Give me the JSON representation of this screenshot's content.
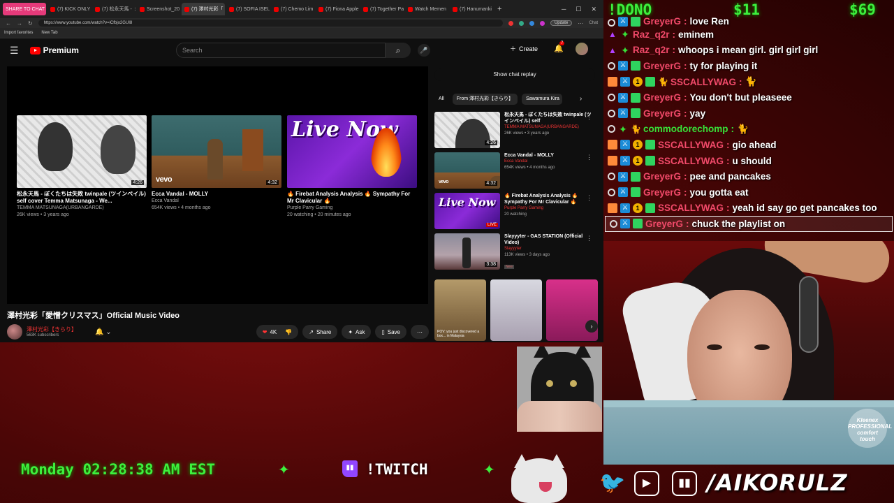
{
  "browser": {
    "tabs": [
      {
        "label": "SHARE TO CHAT",
        "active": false,
        "style": "pink"
      },
      {
        "label": "(7) KICK ONLY",
        "active": false
      },
      {
        "label": "(7) 松永天馬 -",
        "active": false
      },
      {
        "label": "Screenshot_20",
        "active": false
      },
      {
        "label": "(7) 澤村光彩「",
        "active": true
      },
      {
        "label": "(7) SOFIA ISELL",
        "active": false
      },
      {
        "label": "(7) Chemo Lim",
        "active": false
      },
      {
        "label": "(7) Fiona Apple",
        "active": false
      },
      {
        "label": "(7) Together Pa",
        "active": false
      },
      {
        "label": "Watch Memen",
        "active": false
      },
      {
        "label": "(7) Hanumanki",
        "active": false
      }
    ],
    "url": "https://www.youtube.com/watch?v=iCfbjo2GUI8",
    "update_label": "Update",
    "chat_label": "Chat",
    "bookmarks": [
      "Import favorites",
      "New Tab"
    ]
  },
  "youtube": {
    "logo": "Premium",
    "search_placeholder": "Search",
    "create_label": "Create",
    "notif_count": "7",
    "endcards": [
      {
        "title": "松永天馬 - ぼくたちは失敗 twinpale (ツインペイル) self cover Temma Matsunaga - We...",
        "channel": "TEMMA MATSUNAGA(URBANGARDE)",
        "meta": "26K views • 3 years ago",
        "duration": "4:26",
        "kind": "manga"
      },
      {
        "title": "Ecca Vandal - MOLLY",
        "channel": "Ecca Vandal",
        "meta": "654K views • 4 months ago",
        "duration": "4:32",
        "kind": "room",
        "overlay": "vevo"
      },
      {
        "title": "🔥 Firebat Analysis Analysis 🔥 Sympathy For Mr Clavicular 🔥",
        "channel": "Purple Parry Gaming",
        "meta": "20 watching • 20 minutes ago",
        "kind": "live",
        "overlay": "Live Now"
      }
    ],
    "video_title": "澤村光彩「愛憎クリスマス」Official Music Video",
    "channel_name": "澤村光彩【きらり】",
    "subscribers": "563K subscribers",
    "likes": "4K",
    "share_label": "Share",
    "ask_label": "Ask",
    "save_label": "Save",
    "show_chat_replay": "Show chat replay",
    "chips": [
      {
        "label": "All",
        "selected": false
      },
      {
        "label": "From 澤村光彩【きらり】",
        "selected": true
      },
      {
        "label": "Sawamura Kira",
        "selected": false
      }
    ],
    "recommendations": [
      {
        "title": "松永天馬 - ぼくたちは失敗 twinpale (ツインペイル) self",
        "channel": "TEMMA MATSUNAGA(URBANGARDE)",
        "meta": "26K views • 3 years ago",
        "duration": "4:26",
        "kind": "manga"
      },
      {
        "title": "Ecca Vandal - MOLLY",
        "channel": "Ecca Vandal",
        "meta": "654K views • 4 months ago",
        "duration": "4:32",
        "kind": "room",
        "overlay": "vevo"
      },
      {
        "title": "🔥 Firebat Analysis Analysis 🔥 Sympathy For Mr Clavicular 🔥",
        "channel": "Purple Parry Gaming",
        "meta": "20 watching",
        "badge": "LIVE",
        "kind": "live",
        "overlay": "Live Now"
      },
      {
        "title": "Slayyyter - GAS STATION (Official Video)",
        "channel": "Slayyyter",
        "meta": "113K views • 3 days ago",
        "duration": "3:38",
        "badge": "New",
        "kind": "stage"
      }
    ],
    "shorts": [
      {
        "caption": "POV: you just discovered a box... in Malaysia"
      },
      {
        "caption": ""
      },
      {
        "caption": ""
      }
    ]
  },
  "overlay": {
    "dono_cmd": "!DONO",
    "dono_amount_1": "$11",
    "dono_amount_2": "$69",
    "chat": [
      {
        "user": "GreyerG",
        "text": "love Ren",
        "color": "red",
        "badges": [
          "user",
          "sword",
          "gift"
        ],
        "partial": true
      },
      {
        "user": "Raz_q2r",
        "text": "eminem",
        "color": "red",
        "badges": [
          "crown",
          "star"
        ]
      },
      {
        "user": "Raz_q2r",
        "text": "whoops i mean girl. girl girl girl",
        "color": "red",
        "badges": [
          "crown",
          "star"
        ]
      },
      {
        "user": "GreyerG",
        "text": "ty for playing it",
        "color": "red",
        "badges": [
          "user",
          "sword",
          "gift"
        ]
      },
      {
        "user": "SSCALLYWAG",
        "text": "🐈",
        "color": "red",
        "badges": [
          "mod",
          "sword",
          "one",
          "gift",
          "cat"
        ]
      },
      {
        "user": "GreyerG",
        "text": "You don't but pleaseee",
        "color": "red",
        "badges": [
          "user",
          "sword",
          "gift"
        ]
      },
      {
        "user": "GreyerG",
        "text": "yay",
        "color": "red",
        "badges": [
          "user",
          "sword",
          "gift"
        ]
      },
      {
        "user": "commodorechomp",
        "text": "🐈",
        "color": "green",
        "badges": [
          "user",
          "star",
          "cat"
        ]
      },
      {
        "user": "SSCALLYWAG",
        "text": "gio ahead",
        "color": "red",
        "badges": [
          "mod",
          "sword",
          "one",
          "gift"
        ]
      },
      {
        "user": "SSCALLYWAG",
        "text": "u should",
        "color": "red",
        "badges": [
          "mod",
          "sword",
          "one",
          "gift"
        ]
      },
      {
        "user": "GreyerG",
        "text": "pee and pancakes",
        "color": "red",
        "badges": [
          "user",
          "sword",
          "gift"
        ]
      },
      {
        "user": "GreyerG",
        "text": "you gotta eat",
        "color": "red",
        "badges": [
          "user",
          "sword",
          "gift"
        ]
      },
      {
        "user": "SSCALLYWAG",
        "text": "yeah id say go get pancakes too",
        "color": "red",
        "badges": [
          "mod",
          "sword",
          "one",
          "gift"
        ]
      },
      {
        "user": "GreyerG",
        "text": "chuck the playlist on",
        "color": "red",
        "badges": [
          "user",
          "sword",
          "gift"
        ],
        "highlight": true
      }
    ],
    "kleenex_label": "Kleenex\nPROFESSIONAL\ncomfort\ntouch",
    "clock": "Monday 02:28:38 AM EST",
    "twitch_cmd": "!TWITCH",
    "handle": "/AIKORULZ"
  },
  "colors": {
    "accent_green": "#3df03d",
    "username_red": "#f24a6a",
    "youtube_red": "#ff0000",
    "twitch_purple": "#9146ff"
  }
}
